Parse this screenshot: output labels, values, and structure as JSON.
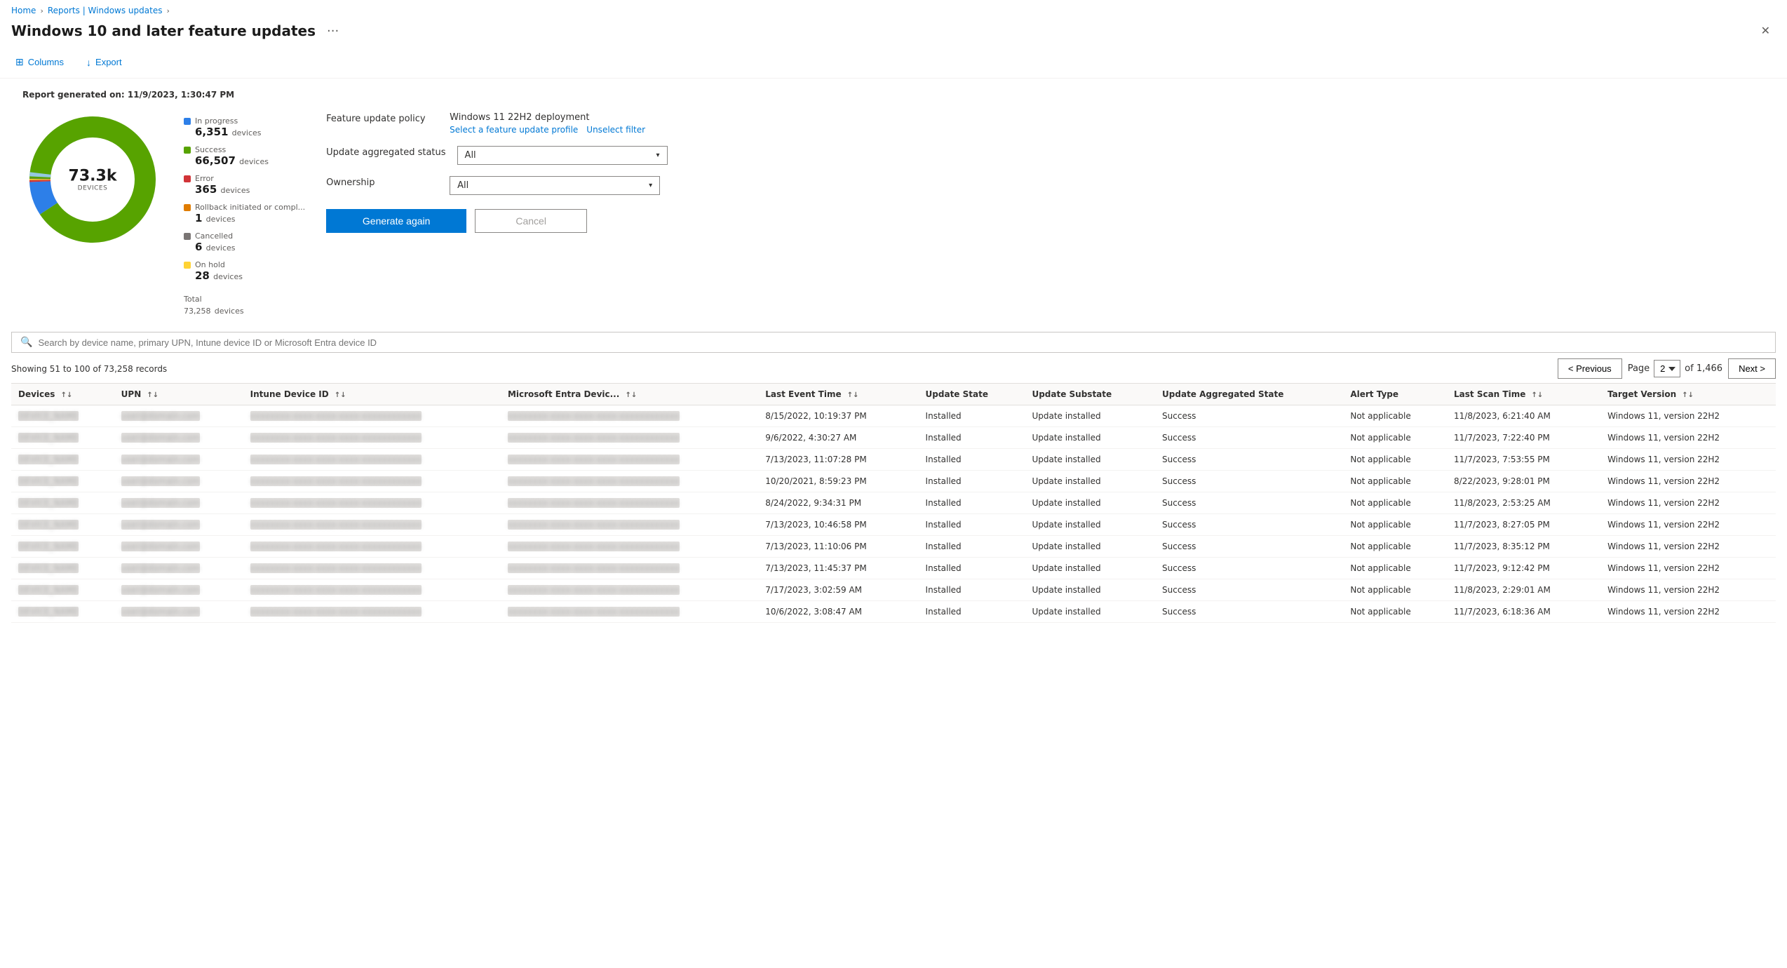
{
  "breadcrumb": {
    "home": "Home",
    "separator1": ">",
    "reports": "Reports | Windows updates",
    "separator2": ">"
  },
  "page": {
    "title": "Windows 10 and later feature updates",
    "close_label": "✕",
    "more_label": "···"
  },
  "toolbar": {
    "columns_label": "Columns",
    "export_label": "Export"
  },
  "report": {
    "generated_label": "Report generated on: 11/9/2023, 1:30:47 PM",
    "donut": {
      "center_number": "73.3k",
      "center_label": "DEVICES"
    },
    "legend": [
      {
        "color": "#2d7fe8",
        "label": "In progress",
        "count": "6,351",
        "unit": "devices"
      },
      {
        "color": "#57a300",
        "label": "Success",
        "count": "66,507",
        "unit": "devices"
      },
      {
        "color": "#d13438",
        "label": "Error",
        "count": "365",
        "unit": "devices"
      },
      {
        "color": "#e07c00",
        "label": "Rollback initiated or compl...",
        "count": "1",
        "unit": "devices"
      },
      {
        "color": "#7a7574",
        "label": "Cancelled",
        "count": "6",
        "unit": "devices"
      },
      {
        "color": "#ffd335",
        "label": "On hold",
        "count": "28",
        "unit": "devices"
      }
    ],
    "total_label": "Total",
    "total_count": "73,258",
    "total_unit": "devices"
  },
  "policy": {
    "feature_update_label": "Feature update policy",
    "feature_update_value": "Windows 11 22H2 deployment",
    "select_profile_link": "Select a feature update profile",
    "unselect_filter_link": "Unselect filter",
    "update_aggregated_label": "Update aggregated status",
    "update_aggregated_value": "All",
    "ownership_label": "Ownership",
    "ownership_value": "All",
    "generate_btn": "Generate again",
    "cancel_btn": "Cancel"
  },
  "search": {
    "placeholder": "Search by device name, primary UPN, Intune device ID or Microsoft Entra device ID"
  },
  "table": {
    "showing_text": "Showing 51 to 100 of 73,258 records",
    "pagination": {
      "previous_label": "< Previous",
      "next_label": "Next >",
      "page_label": "Page",
      "current_page": "2",
      "of_label": "of 1,466"
    },
    "columns": [
      {
        "key": "devices",
        "label": "Devices",
        "sortable": true
      },
      {
        "key": "upn",
        "label": "UPN",
        "sortable": true
      },
      {
        "key": "intune_device_id",
        "label": "Intune Device ID",
        "sortable": true
      },
      {
        "key": "ms_entra_device",
        "label": "Microsoft Entra Devic...",
        "sortable": true
      },
      {
        "key": "last_event_time",
        "label": "Last Event Time",
        "sortable": true
      },
      {
        "key": "update_state",
        "label": "Update State",
        "sortable": false
      },
      {
        "key": "update_substate",
        "label": "Update Substate",
        "sortable": false
      },
      {
        "key": "update_aggregated_state",
        "label": "Update Aggregated State",
        "sortable": false
      },
      {
        "key": "alert_type",
        "label": "Alert Type",
        "sortable": false
      },
      {
        "key": "last_scan_time",
        "label": "Last Scan Time",
        "sortable": true
      },
      {
        "key": "target_version",
        "label": "Target Version",
        "sortable": true
      }
    ],
    "rows": [
      {
        "last_event_time": "8/15/2022, 10:19:37 PM",
        "update_state": "Installed",
        "update_substate": "Update installed",
        "update_aggregated_state": "Success",
        "alert_type": "Not applicable",
        "last_scan_time": "11/8/2023, 6:21:40 AM",
        "target_version": "Windows 11, version 22H2"
      },
      {
        "last_event_time": "9/6/2022, 4:30:27 AM",
        "update_state": "Installed",
        "update_substate": "Update installed",
        "update_aggregated_state": "Success",
        "alert_type": "Not applicable",
        "last_scan_time": "11/7/2023, 7:22:40 PM",
        "target_version": "Windows 11, version 22H2"
      },
      {
        "last_event_time": "7/13/2023, 11:07:28 PM",
        "update_state": "Installed",
        "update_substate": "Update installed",
        "update_aggregated_state": "Success",
        "alert_type": "Not applicable",
        "last_scan_time": "11/7/2023, 7:53:55 PM",
        "target_version": "Windows 11, version 22H2"
      },
      {
        "last_event_time": "10/20/2021, 8:59:23 PM",
        "update_state": "Installed",
        "update_substate": "Update installed",
        "update_aggregated_state": "Success",
        "alert_type": "Not applicable",
        "last_scan_time": "8/22/2023, 9:28:01 PM",
        "target_version": "Windows 11, version 22H2"
      },
      {
        "last_event_time": "8/24/2022, 9:34:31 PM",
        "update_state": "Installed",
        "update_substate": "Update installed",
        "update_aggregated_state": "Success",
        "alert_type": "Not applicable",
        "last_scan_time": "11/8/2023, 2:53:25 AM",
        "target_version": "Windows 11, version 22H2"
      },
      {
        "last_event_time": "7/13/2023, 10:46:58 PM",
        "update_state": "Installed",
        "update_substate": "Update installed",
        "update_aggregated_state": "Success",
        "alert_type": "Not applicable",
        "last_scan_time": "11/7/2023, 8:27:05 PM",
        "target_version": "Windows 11, version 22H2"
      },
      {
        "last_event_time": "7/13/2023, 11:10:06 PM",
        "update_state": "Installed",
        "update_substate": "Update installed",
        "update_aggregated_state": "Success",
        "alert_type": "Not applicable",
        "last_scan_time": "11/7/2023, 8:35:12 PM",
        "target_version": "Windows 11, version 22H2"
      },
      {
        "last_event_time": "7/13/2023, 11:45:37 PM",
        "update_state": "Installed",
        "update_substate": "Update installed",
        "update_aggregated_state": "Success",
        "alert_type": "Not applicable",
        "last_scan_time": "11/7/2023, 9:12:42 PM",
        "target_version": "Windows 11, version 22H2"
      },
      {
        "last_event_time": "7/17/2023, 3:02:59 AM",
        "update_state": "Installed",
        "update_substate": "Update installed",
        "update_aggregated_state": "Success",
        "alert_type": "Not applicable",
        "last_scan_time": "11/8/2023, 2:29:01 AM",
        "target_version": "Windows 11, version 22H2"
      },
      {
        "last_event_time": "10/6/2022, 3:08:47 AM",
        "update_state": "Installed",
        "update_substate": "Update installed",
        "update_aggregated_state": "Success",
        "alert_type": "Not applicable",
        "last_scan_time": "11/7/2023, 6:18:36 AM",
        "target_version": "Windows 11, version 22H2"
      }
    ]
  },
  "colors": {
    "in_progress": "#2d7fe8",
    "success": "#57a300",
    "error": "#d13438",
    "rollback": "#e07c00",
    "cancelled": "#7a7574",
    "on_hold": "#ffd335",
    "accent": "#0078d4"
  }
}
